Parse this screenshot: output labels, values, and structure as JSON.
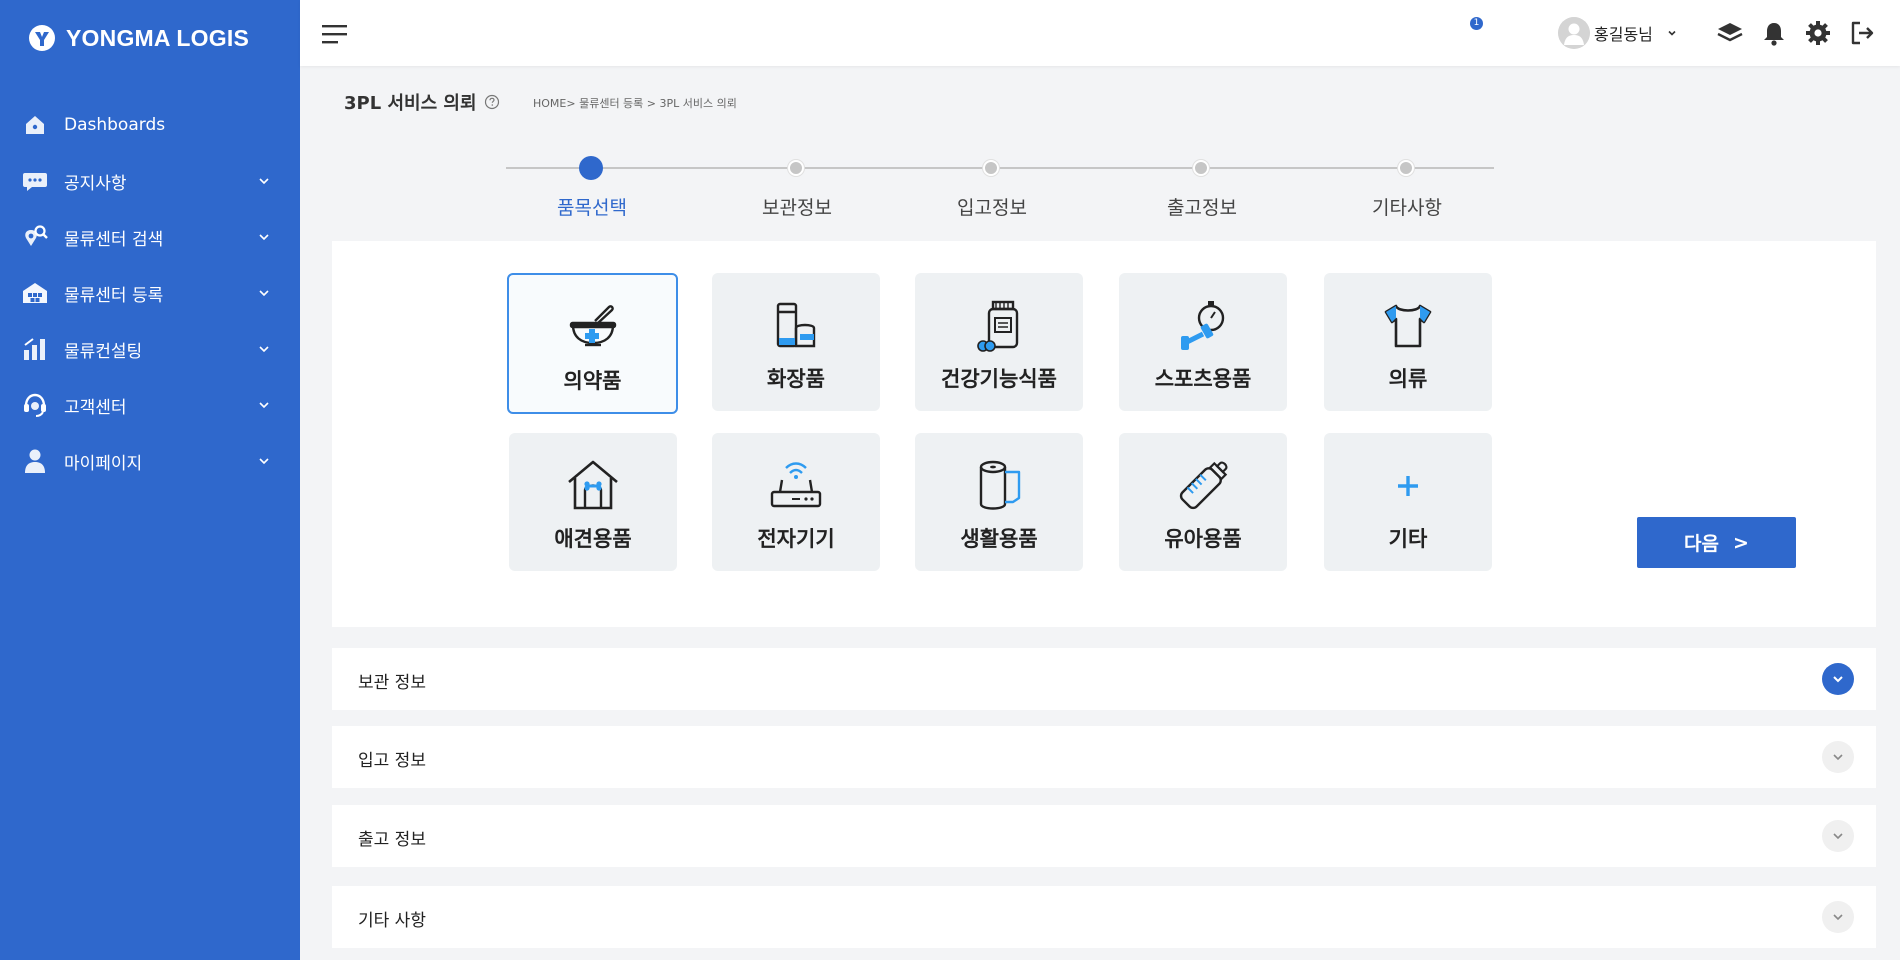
{
  "brand": {
    "name": "YONGMA LOGIS"
  },
  "sidebar": {
    "items": [
      {
        "label": "Dashboards",
        "icon": "home-icon"
      },
      {
        "label": "공지사항",
        "icon": "chat-bubble-icon"
      },
      {
        "label": "물류센터 검색",
        "icon": "location-search-icon"
      },
      {
        "label": "물류센터 등록",
        "icon": "warehouse-icon"
      },
      {
        "label": "물류컨설팅",
        "icon": "bar-chart-icon"
      },
      {
        "label": "고객센터",
        "icon": "headset-icon"
      },
      {
        "label": "마이페이지",
        "icon": "user-icon"
      }
    ]
  },
  "header": {
    "user_name": "홍길동님",
    "notification_count": "1"
  },
  "page": {
    "title": "3PL 서비스 의뢰",
    "breadcrumb": "HOME> 물류센터 등록 > 3PL 서비스 의뢰"
  },
  "stepper": {
    "steps": [
      "품목선택",
      "보관정보",
      "입고정보",
      "출고정보",
      "기타사항"
    ],
    "active_index": 0
  },
  "categories": [
    {
      "label": "의약품",
      "icon": "mortar-pestle-icon",
      "selected": true
    },
    {
      "label": "화장품",
      "icon": "cosmetics-icon"
    },
    {
      "label": "건강기능식품",
      "icon": "supplement-bottle-icon"
    },
    {
      "label": "스포츠용품",
      "icon": "dumbbell-stopwatch-icon"
    },
    {
      "label": "의류",
      "icon": "shirt-icon"
    },
    {
      "label": "애견용품",
      "icon": "dog-house-icon"
    },
    {
      "label": "전자기기",
      "icon": "router-icon"
    },
    {
      "label": "생활용품",
      "icon": "tissue-roll-icon"
    },
    {
      "label": "유아용품",
      "icon": "baby-bottle-icon"
    },
    {
      "label": "기타",
      "icon": "plus-icon"
    }
  ],
  "actions": {
    "next_label": "다음",
    "next_glyph": ">"
  },
  "accordions": [
    {
      "title": "보관 정보",
      "open": true
    },
    {
      "title": "입고 정보",
      "open": false
    },
    {
      "title": "출고 정보",
      "open": false
    },
    {
      "title": "기타 사항",
      "open": false
    }
  ],
  "colors": {
    "primary": "#2f68cc",
    "accent": "#3e8ee8",
    "icon_blue": "#2e9bf0",
    "tile_bg": "#eef1f3"
  }
}
